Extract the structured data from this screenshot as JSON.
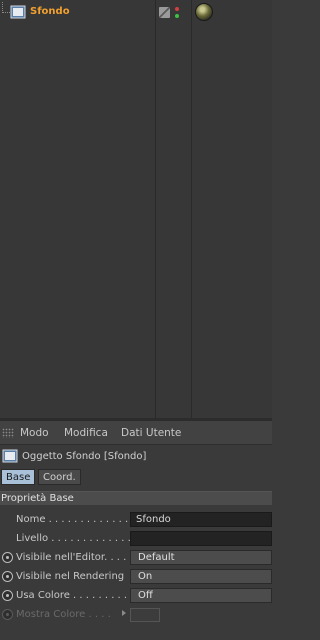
{
  "object_manager": {
    "object_name": "Sfondo",
    "object_name_color": "#f0a030"
  },
  "attributes": {
    "menu": [
      "Modo",
      "Modifica",
      "Dati Utente"
    ],
    "object_title": "Oggetto Sfondo [Sfondo]",
    "tabs": [
      "Base",
      "Coord."
    ],
    "section_title": "Proprietà Base",
    "props": {
      "nome_label": "Nome . . . . . . . . . . . . . .",
      "nome_value": "Sfondo",
      "livello_label": "Livello . . . . . . . . . . . . .",
      "livello_value": "",
      "vis_editor_label": "Visibile nell'Editor. . . .",
      "vis_editor_value": "Default",
      "vis_render_label": "Visibile nel Rendering",
      "vis_render_value": "On",
      "usa_colore_label": "Usa Colore . . . . . . . . . .",
      "usa_colore_value": "Off",
      "mostra_colore_label": "Mostra Colore . . . ."
    }
  }
}
